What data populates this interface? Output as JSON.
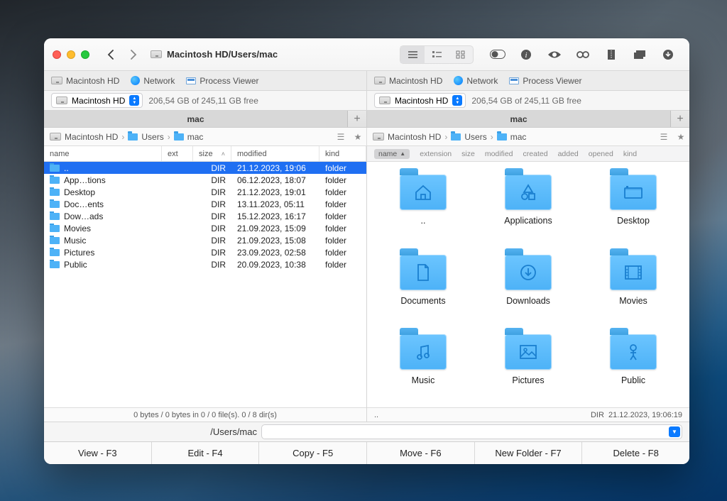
{
  "window": {
    "title": "Macintosh HD/Users/mac"
  },
  "favorites": [
    {
      "icon": "disk",
      "label": "Macintosh HD"
    },
    {
      "icon": "globe",
      "label": "Network"
    },
    {
      "icon": "proc",
      "label": "Process Viewer"
    }
  ],
  "drive": {
    "name": "Macintosh HD",
    "free": "206,54 GB of 245,11 GB free"
  },
  "tab": {
    "label": "mac"
  },
  "breadcrumbs": [
    {
      "icon": "disk",
      "label": "Macintosh HD"
    },
    {
      "icon": "folder",
      "label": "Users"
    },
    {
      "icon": "folder",
      "label": "mac"
    }
  ],
  "left": {
    "columns": {
      "name": "name",
      "ext": "ext",
      "size": "size",
      "modified": "modified",
      "kind": "kind"
    },
    "rows": [
      {
        "name": "..",
        "ext": "",
        "size": "DIR",
        "modified": "21.12.2023, 19:06",
        "kind": "folder",
        "selected": true
      },
      {
        "name": "App…tions",
        "ext": "",
        "size": "DIR",
        "modified": "06.12.2023, 18:07",
        "kind": "folder"
      },
      {
        "name": "Desktop",
        "ext": "",
        "size": "DIR",
        "modified": "21.12.2023, 19:01",
        "kind": "folder"
      },
      {
        "name": "Doc…ents",
        "ext": "",
        "size": "DIR",
        "modified": "13.11.2023, 05:11",
        "kind": "folder"
      },
      {
        "name": "Dow…ads",
        "ext": "",
        "size": "DIR",
        "modified": "15.12.2023, 16:17",
        "kind": "folder"
      },
      {
        "name": "Movies",
        "ext": "",
        "size": "DIR",
        "modified": "21.09.2023, 15:09",
        "kind": "folder"
      },
      {
        "name": "Music",
        "ext": "",
        "size": "DIR",
        "modified": "21.09.2023, 15:08",
        "kind": "folder"
      },
      {
        "name": "Pictures",
        "ext": "",
        "size": "DIR",
        "modified": "23.09.2023, 02:58",
        "kind": "folder"
      },
      {
        "name": "Public",
        "ext": "",
        "size": "DIR",
        "modified": "20.09.2023, 10:38",
        "kind": "folder"
      }
    ],
    "status": "0 bytes / 0 bytes in 0 / 0 file(s). 0 / 8 dir(s)"
  },
  "right": {
    "columns": [
      "name",
      "extension",
      "size",
      "modified",
      "created",
      "added",
      "opened",
      "kind"
    ],
    "sort_col": "name",
    "items": [
      {
        "label": "..",
        "glyph": "home"
      },
      {
        "label": "Applications",
        "glyph": "apps"
      },
      {
        "label": "Desktop",
        "glyph": "desktop"
      },
      {
        "label": "Documents",
        "glyph": "doc"
      },
      {
        "label": "Downloads",
        "glyph": "download"
      },
      {
        "label": "Movies",
        "glyph": "movie"
      },
      {
        "label": "Music",
        "glyph": "music"
      },
      {
        "label": "Pictures",
        "glyph": "picture"
      },
      {
        "label": "Public",
        "glyph": "public"
      }
    ],
    "status_left": "..",
    "status_dir": "DIR",
    "status_time": "21.12.2023, 19:06:19"
  },
  "path": "/Users/mac",
  "bottom": {
    "view": "View - F3",
    "edit": "Edit - F4",
    "copy": "Copy - F5",
    "move": "Move - F6",
    "newfolder": "New Folder - F7",
    "delete": "Delete - F8"
  }
}
